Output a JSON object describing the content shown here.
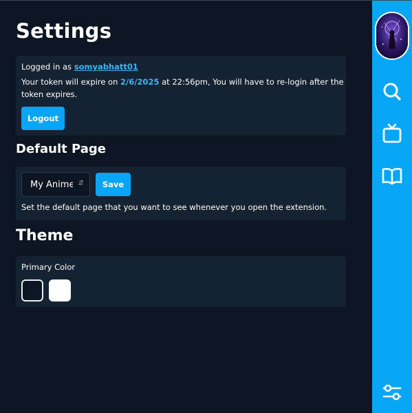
{
  "page": {
    "title": "Settings"
  },
  "auth": {
    "logged_in_prefix": "Logged in as ",
    "username": "somyabhatt01",
    "token_prefix": "Your token will expire on ",
    "expiry_date": "2/6/2025",
    "token_suffix_line1": " at 22:56pm, You will have to re-login after the",
    "token_line2": "token expires.",
    "logout_label": "Logout"
  },
  "default_page": {
    "heading": "Default Page",
    "selected": "My Anime",
    "save_label": "Save",
    "description": "Set the default page that you want to see whenever you open the extension."
  },
  "theme": {
    "heading": "Theme",
    "primary_color_label": "Primary Color",
    "swatches": [
      {
        "name": "dark",
        "color": "#0b1622"
      },
      {
        "name": "white",
        "color": "#ffffff"
      }
    ]
  },
  "sidebar": {
    "items": [
      {
        "name": "avatar"
      },
      {
        "name": "search-icon"
      },
      {
        "name": "tv-icon"
      },
      {
        "name": "book-icon"
      },
      {
        "name": "settings-sliders-icon"
      }
    ]
  },
  "colors": {
    "background": "#0b1622",
    "card": "#152232",
    "accent": "#0aa6f6",
    "link": "#3db4f2"
  }
}
